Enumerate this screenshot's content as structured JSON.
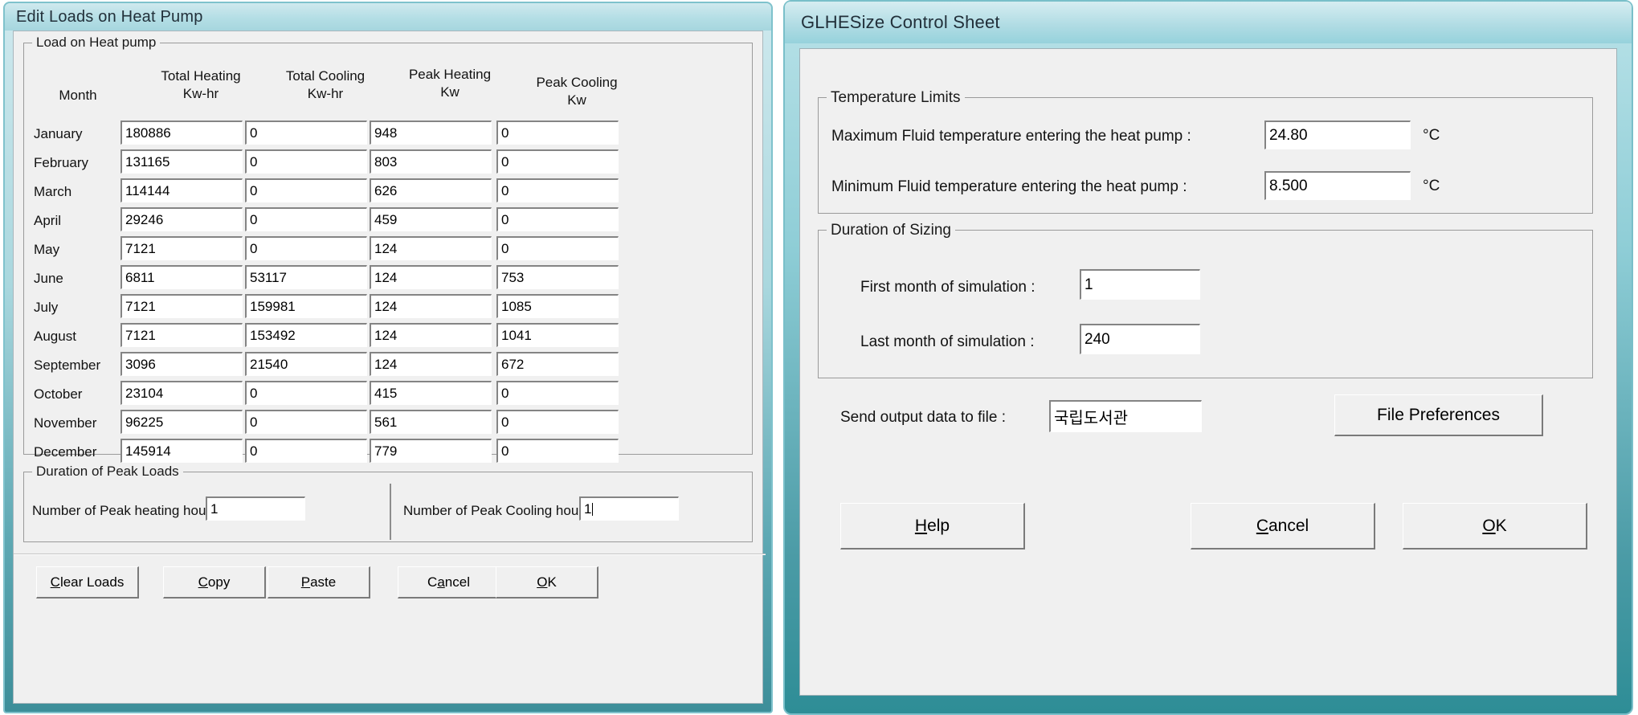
{
  "left_window": {
    "title": "Edit Loads on Heat Pump",
    "group_loads": {
      "caption": "Load on Heat pump",
      "columns": [
        {
          "name": "Month",
          "unit": ""
        },
        {
          "name": "Total Heating",
          "unit": "Kw-hr"
        },
        {
          "name": "Total Cooling",
          "unit": "Kw-hr"
        },
        {
          "name": "Peak Heating",
          "unit": "Kw"
        },
        {
          "name": "Peak Cooling",
          "unit": "Kw"
        }
      ],
      "rows": [
        {
          "month": "January",
          "total_heating": "180886",
          "total_cooling": "0",
          "peak_heating": "948",
          "peak_cooling": "0"
        },
        {
          "month": "February",
          "total_heating": "131165",
          "total_cooling": "0",
          "peak_heating": "803",
          "peak_cooling": "0"
        },
        {
          "month": "March",
          "total_heating": "114144",
          "total_cooling": "0",
          "peak_heating": "626",
          "peak_cooling": "0"
        },
        {
          "month": "April",
          "total_heating": "29246",
          "total_cooling": "0",
          "peak_heating": "459",
          "peak_cooling": "0"
        },
        {
          "month": "May",
          "total_heating": "7121",
          "total_cooling": "0",
          "peak_heating": "124",
          "peak_cooling": "0"
        },
        {
          "month": "June",
          "total_heating": "6811",
          "total_cooling": "53117",
          "peak_heating": "124",
          "peak_cooling": "753"
        },
        {
          "month": "July",
          "total_heating": "7121",
          "total_cooling": "159981",
          "peak_heating": "124",
          "peak_cooling": "1085"
        },
        {
          "month": "August",
          "total_heating": "7121",
          "total_cooling": "153492",
          "peak_heating": "124",
          "peak_cooling": "1041"
        },
        {
          "month": "September",
          "total_heating": "3096",
          "total_cooling": "21540",
          "peak_heating": "124",
          "peak_cooling": "672"
        },
        {
          "month": "October",
          "total_heating": "23104",
          "total_cooling": "0",
          "peak_heating": "415",
          "peak_cooling": "0"
        },
        {
          "month": "November",
          "total_heating": "96225",
          "total_cooling": "0",
          "peak_heating": "561",
          "peak_cooling": "0"
        },
        {
          "month": "December",
          "total_heating": "145914",
          "total_cooling": "0",
          "peak_heating": "779",
          "peak_cooling": "0"
        }
      ]
    },
    "group_peak": {
      "caption": "Duration of Peak Loads",
      "heating_label": "Number of Peak heating hours :",
      "heating_value": "1",
      "cooling_label": "Number of Peak Cooling hours :",
      "cooling_value": "1"
    },
    "buttons": {
      "clear_loads": "Clear Loads",
      "copy": "Copy",
      "paste": "Paste",
      "cancel": "Cancel",
      "ok": "OK"
    }
  },
  "right_window": {
    "title": "GLHESize Control Sheet",
    "group_temp": {
      "caption": "Temperature Limits",
      "max_label": "Maximum Fluid temperature entering the heat pump :",
      "max_value": "24.80",
      "max_unit": "°C",
      "min_label": "Minimum Fluid temperature entering the heat pump :",
      "min_value": "8.500",
      "min_unit": "°C"
    },
    "group_duration": {
      "caption": "Duration of Sizing",
      "first_label": "First month of simulation :",
      "first_value": "1",
      "last_label": "Last month of simulation :",
      "last_value": "240"
    },
    "output": {
      "label": "Send output data to file :",
      "value": "국립도서관",
      "file_preferences": "File Preferences"
    },
    "buttons": {
      "help": "Help",
      "cancel": "Cancel",
      "ok": "OK"
    }
  },
  "colors": {
    "title_bar_start": "#b6dde4",
    "title_bar_end": "#d8ecef",
    "window_face": "#f0f0f0",
    "frame": "#9a9a9a",
    "teal_edge": "#2e8d96"
  }
}
